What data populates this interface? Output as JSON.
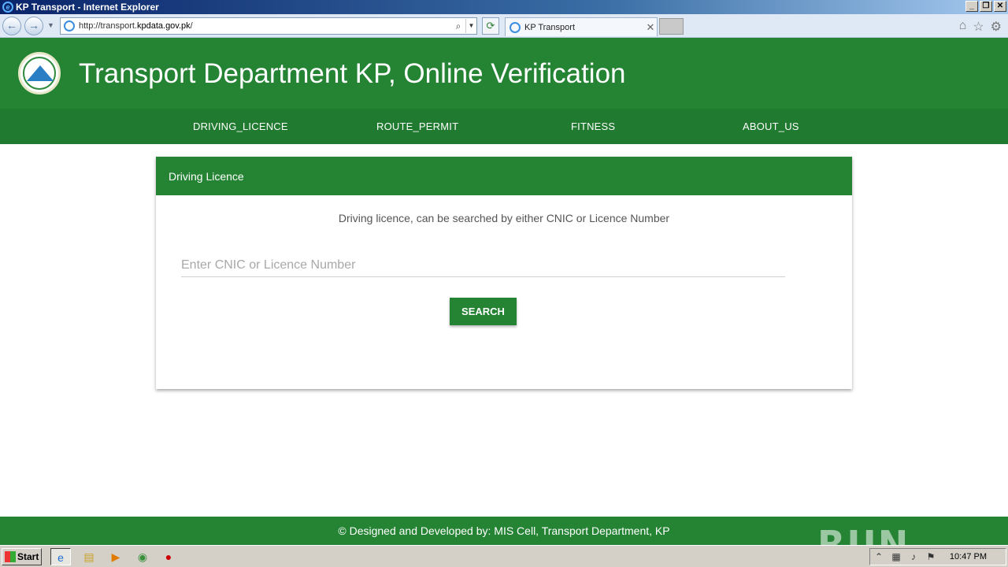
{
  "window": {
    "title": "KP Transport - Internet Explorer"
  },
  "browser": {
    "url_prefix": "http://transport.",
    "url_domain": "kpdata.gov.pk",
    "url_suffix": "/",
    "tab_label": "KP Transport"
  },
  "header": {
    "title": "Transport Department KP, Online Verification"
  },
  "menu": {
    "items": [
      "DRIVING_LICENCE",
      "ROUTE_PERMIT",
      "FITNESS",
      "ABOUT_US"
    ]
  },
  "card": {
    "title": "Driving Licence",
    "description": "Driving licence, can be searched by either CNIC or Licence Number",
    "input_placeholder": "Enter CNIC or Licence Number",
    "input_value": "",
    "search_label": "SEARCH"
  },
  "footer": {
    "text": "© Designed and Developed by: MIS Cell, Transport Department, KP"
  },
  "watermark": "ANY RUN",
  "taskbar": {
    "start_label": "Start",
    "clock": "10:47 PM"
  },
  "colors": {
    "primary_green": "#258334",
    "menu_green": "#207a2f"
  }
}
